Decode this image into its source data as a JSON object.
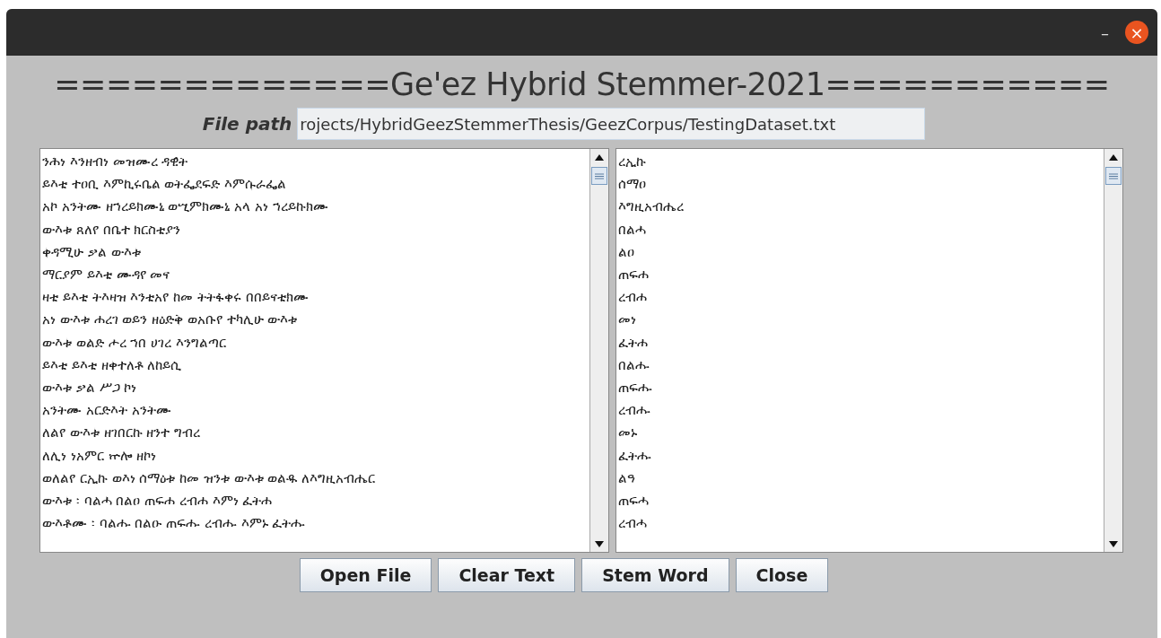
{
  "window": {
    "title": "=============Ge'ez Hybrid Stemmer-2021===========",
    "controls": [
      "–",
      "×"
    ]
  },
  "file_path": {
    "label": "File path",
    "value": "rojects/HybridGeezStemmerThesis/GeezCorpus/TestingDataset.txt"
  },
  "input_text": {
    "lines": [
      "ንሕነ እንዘብነ መዝሙረ ዳዊት",
      "ይእቲ ተዐቢ እምኪሩቤል ወትፌደፍድ እምሱራፌል",
      "አኮ አንትሙ ዘኀረይክሙኒ ወሢምክሙኒ አላ አነ ኀረይኩክሙ",
      "ውእቱ ጸለየ በቤተ ክርስቲያን",
      "ቀዳሚሁ ቃል ውእቱ",
      "ማርያም ይእቲ ሙዳየ መና",
      "ዛቲ ይእቲ ትእዛዝ እንቲአየ ከመ ትትፋቀሩ በበይናቲክሙ",
      "አነ ውእቱ ሐረገ ወይን ዘዕድቅ ወአቡየ ተካሊሁ ውእቱ",
      "ውእቱ ወልድ ሖረ ኀበ ሀገረ እንግልጣር",
      "ይእቲ ይእቲ ዘቀተለቶ ለከይሲ",
      "ውእቱ ቃል ሥጋ ኮነ",
      "አንትሙ አርድእት አንትሙ",
      "ለልየ ውእቱ ዘገበርኩ ዘንተ ግብረ",
      "ለሊነ ነአምር ኵሎ ዘኮነ",
      "ወለልየ ርኢኩ ወእነ ሰማዕቱ ከመ ዝንቱ ውእቱ ወልዱ ለእግዚአብሔር",
      "ውእቱ ፡ ባልሓ በልዐ ጠፍሐ ረብሐ እምነ ፈትሐ",
      "ውእቶሙ ፡ ባልሑ በልዑ ጠፍሑ ረብሑ እምኑ ፈትሑ"
    ]
  },
  "output_text": {
    "lines": [
      "ረኢኩ",
      "ሰማዐ",
      "እግዚአብሔረ",
      "በልሓ",
      "ልዐ",
      "ጠፍሐ",
      "ረብሐ",
      "መነ",
      "ፈትሐ",
      "በልሑ",
      "ጠፍሑ",
      "ረብሑ",
      "መኑ",
      "ፈትሑ",
      "ልዓ",
      "ጠፍሓ",
      "ረብሓ"
    ]
  },
  "buttons": [
    "Open File",
    "Clear Text",
    "Stem Word",
    "Close"
  ]
}
